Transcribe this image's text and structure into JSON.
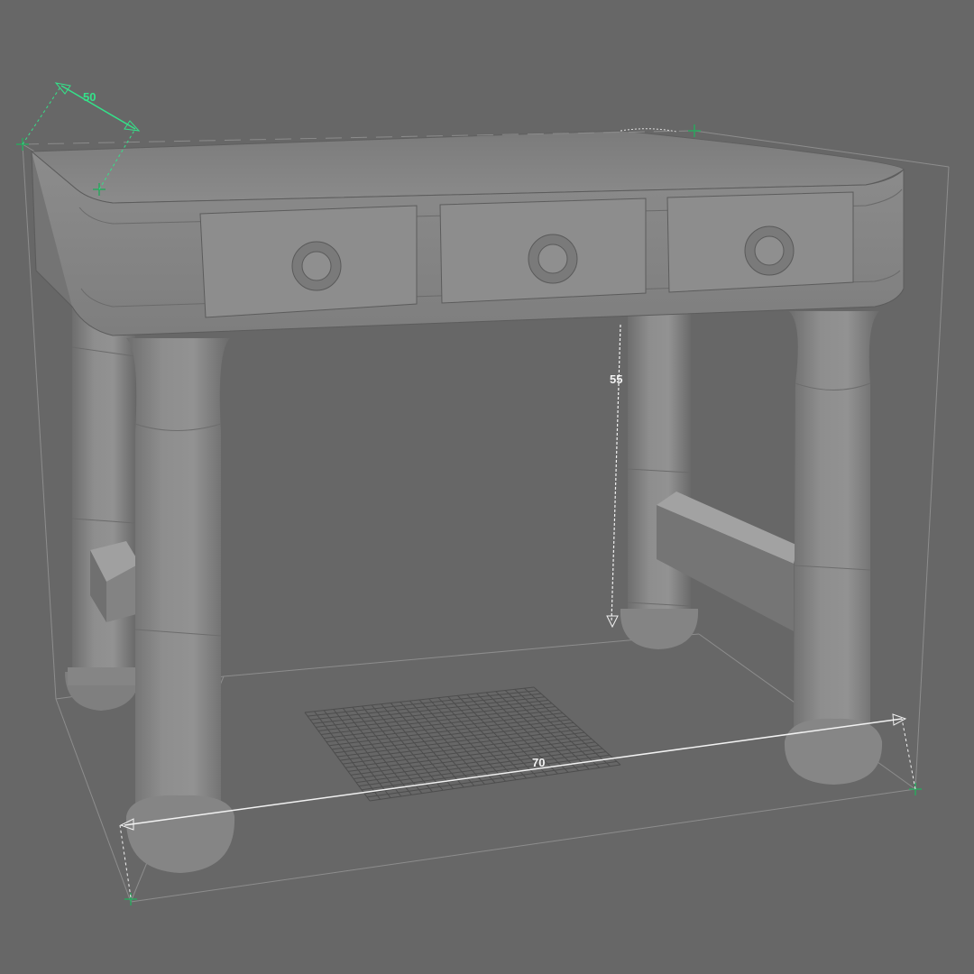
{
  "viewport": {
    "background": "#676767",
    "object": "desk-model",
    "shading": "flat-grey"
  },
  "colors": {
    "model": "#8a8a8a",
    "model_shadow": "#6f6f6f",
    "model_light": "#a8a8a8",
    "dimension_white": "#f2f2f2",
    "dimension_green": "#34e28a",
    "bounding_box": "#8c8c8c",
    "grid": "#4a4a4a"
  },
  "dimensions": {
    "depth": {
      "value": "50",
      "color": "#34e28a"
    },
    "height": {
      "value": "55",
      "color": "#f2f2f2"
    },
    "width": {
      "value": "70",
      "color": "#f2f2f2"
    }
  }
}
